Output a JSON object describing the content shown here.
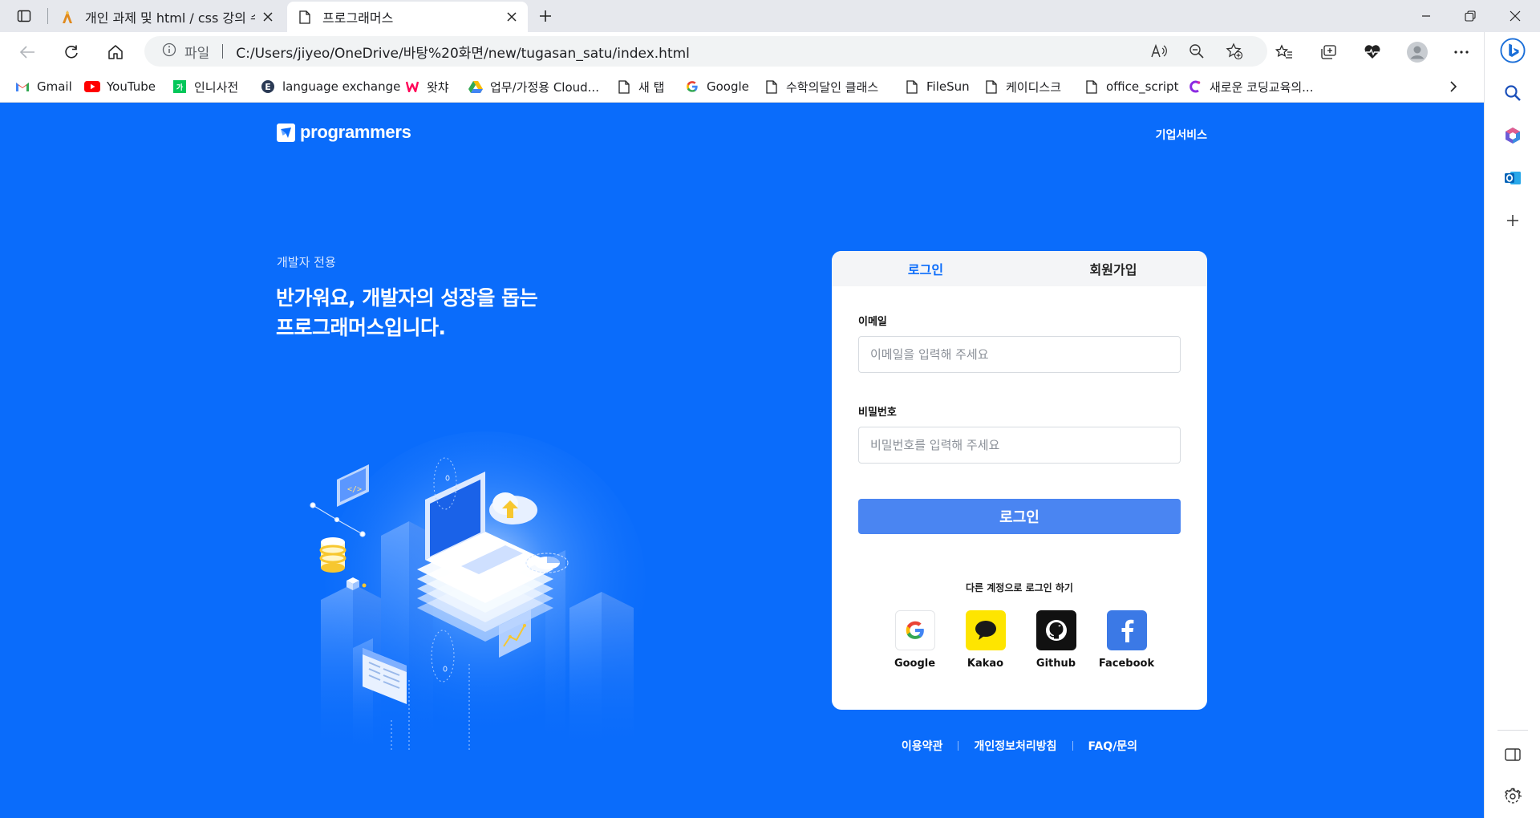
{
  "browser": {
    "tabs": [
      {
        "title": "개인 과제 및 html / css 강의 수강"
      },
      {
        "title": "프로그래머스"
      }
    ],
    "address": {
      "scheme_label": "파일",
      "url": "C:/Users/jiyeo/OneDrive/바탕%20화면/new/tugasan_satu/index.html"
    },
    "bookmarks": [
      {
        "label": "Gmail",
        "icon": "gmail-icon"
      },
      {
        "label": "YouTube",
        "icon": "youtube-icon"
      },
      {
        "label": "인니사전",
        "icon": "dictionary-icon"
      },
      {
        "label": "language exchange",
        "icon": "e-icon"
      },
      {
        "label": "왓챠",
        "icon": "watcha-icon"
      },
      {
        "label": "업무/가정용 Cloud...",
        "icon": "drive-icon"
      },
      {
        "label": "새 탭",
        "icon": "page-icon"
      },
      {
        "label": "Google",
        "icon": "google-icon"
      },
      {
        "label": "수학의달인 클래스",
        "icon": "page-icon"
      },
      {
        "label": "FileSun",
        "icon": "page-icon"
      },
      {
        "label": "케이디스크",
        "icon": "page-icon"
      },
      {
        "label": "office_script",
        "icon": "page-icon"
      },
      {
        "label": "새로운 코딩교육의...",
        "icon": "coding-icon"
      }
    ]
  },
  "page": {
    "logo_text": "programmers",
    "business_link": "기업서비스",
    "eyebrow": "개발자 전용",
    "headline_line1": "반가워요, 개발자의 성장을 돕는",
    "headline_line2": "프로그래머스입니다.",
    "login": {
      "tab_login": "로그인",
      "tab_signup": "회원가입",
      "email_label": "이메일",
      "email_placeholder": "이메일을 입력해 주세요",
      "password_label": "비밀번호",
      "password_placeholder": "비밀번호를 입력해 주세요",
      "submit_label": "로그인",
      "other_accounts": "다른 계정으로 로그인 하기",
      "socials": [
        {
          "name": "Google",
          "color": "#ffffff"
        },
        {
          "name": "Kakao",
          "color": "#fee500"
        },
        {
          "name": "Github",
          "color": "#111111"
        },
        {
          "name": "Facebook",
          "color": "#3b79e6"
        }
      ]
    },
    "footer": [
      "이용약관",
      "개인정보처리방침",
      "FAQ/문의"
    ]
  },
  "colors": {
    "brand_blue": "#0a6cfb",
    "login_button": "#4a85f2"
  }
}
